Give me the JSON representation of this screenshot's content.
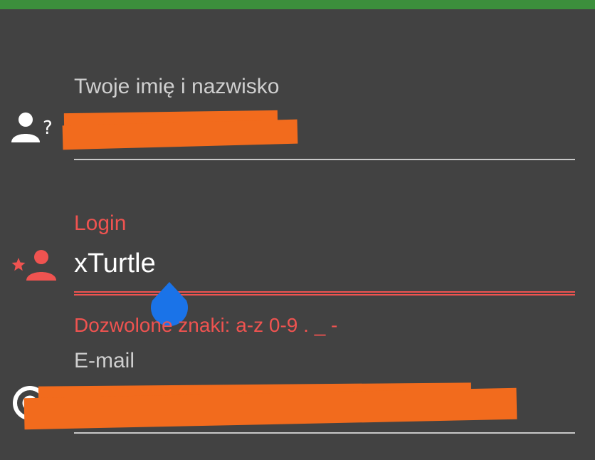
{
  "form": {
    "name_field": {
      "label": "Twoje imię i nazwisko",
      "value_redacted": true,
      "icon": "person-question-icon"
    },
    "login_field": {
      "label": "Login",
      "value": "xTurtle",
      "helper_text": "Dozwolone znaki: a-z 0-9 . _ -",
      "state": "error",
      "icon": "person-star-icon"
    },
    "email_field": {
      "label": "E-mail",
      "value_redacted": true,
      "icon": "at-sign-icon"
    }
  },
  "colors": {
    "background": "#424242",
    "top_bar": "#3c8f3c",
    "error": "#ef5350",
    "redaction": "#f26b1d",
    "cursor_handle": "#1a73e8"
  }
}
